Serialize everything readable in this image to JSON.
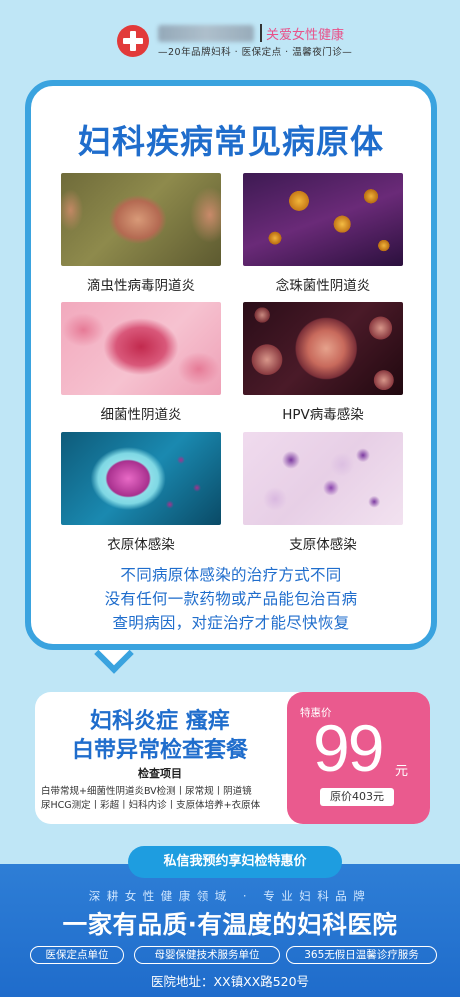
{
  "header": {
    "slogan": "关爱女性健康",
    "tagline": "—20年品牌妇科 · 医保定点 · 温馨夜门诊—"
  },
  "main": {
    "title": "妇科疾病常见病原体",
    "diseases": [
      {
        "label": "滴虫性病毒阴道炎",
        "image": "trichomonas-micrograph"
      },
      {
        "label": "念珠菌性阴道炎",
        "image": "candida-micrograph"
      },
      {
        "label": "细菌性阴道炎",
        "image": "bacteria-micrograph"
      },
      {
        "label": "HPV病毒感染",
        "image": "hpv-virus-render"
      },
      {
        "label": "衣原体感染",
        "image": "chlamydia-cell-render"
      },
      {
        "label": "支原体感染",
        "image": "mycoplasma-micrograph"
      }
    ],
    "message": [
      "不同病原体感染的治疗方式不同",
      "没有任何一款药物或产品能包治百病",
      "查明病因，对症治疗才能尽快恢复"
    ]
  },
  "package": {
    "title_line1": "妇科炎症 瘙痒",
    "title_line2": "白带异常检查套餐",
    "items_label": "检查项目",
    "items_line1": "白带常规+细菌性阴道炎BV检测丨尿常规丨阴道镜",
    "items_line2": "尿HCG测定丨彩超丨妇科内诊丨支原体培养+衣原体",
    "price_label": "特惠价",
    "price": "99",
    "price_unit": "元",
    "original_price": "原价403元"
  },
  "bottom": {
    "cta": "私信我预约享妇检特惠价",
    "tagline": "深耕女性健康领域 · 专业妇科品牌",
    "hospital_name": "一家有品质·有温度的妇科医院",
    "badges": [
      "医保定点单位",
      "母婴保健技术服务单位",
      "365无假日温馨诊疗服务"
    ],
    "address": "医院地址：XX镇XX路520号"
  },
  "colors": {
    "background": "#bfe6f6",
    "primary_blue": "#1f6dcc",
    "card_border": "#3aa3df",
    "price_pink": "#ea5a8e",
    "logo_red": "#e23a3a"
  }
}
